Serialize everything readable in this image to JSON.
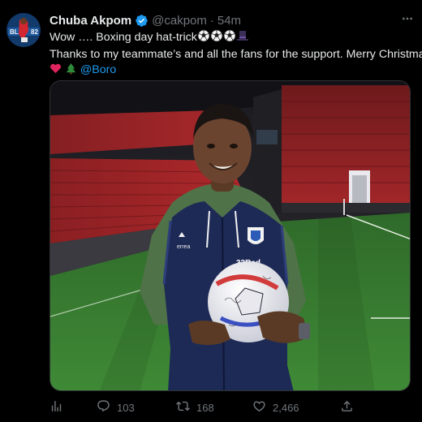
{
  "author": {
    "name": "Chuba Akpom",
    "handle": "@cakpom",
    "separator": "·",
    "time": "54m"
  },
  "tweet": {
    "line1_text": "Wow …. Boxing day hat-trick",
    "line2_text": "Thanks to my teammate’s and all the fans for the support. Merry Christmas",
    "mention": "@Boro",
    "emojis": [
      "soccer-ball",
      "soccer-ball",
      "soccer-ball",
      "top-hat",
      "red-heart",
      "christmas-tree"
    ]
  },
  "media": {
    "shirt_sponsor": "32Red",
    "kit_brand": "errea"
  },
  "metrics": {
    "replies": "103",
    "retweets": "168",
    "likes": "2,466"
  },
  "colors": {
    "background": "#000000",
    "text": "#e7e9ea",
    "muted": "#71767b",
    "accent": "#1d9bf0"
  },
  "icons": [
    "more-icon",
    "verified-icon",
    "analytics-icon",
    "reply-icon",
    "retweet-icon",
    "like-icon",
    "share-icon"
  ]
}
